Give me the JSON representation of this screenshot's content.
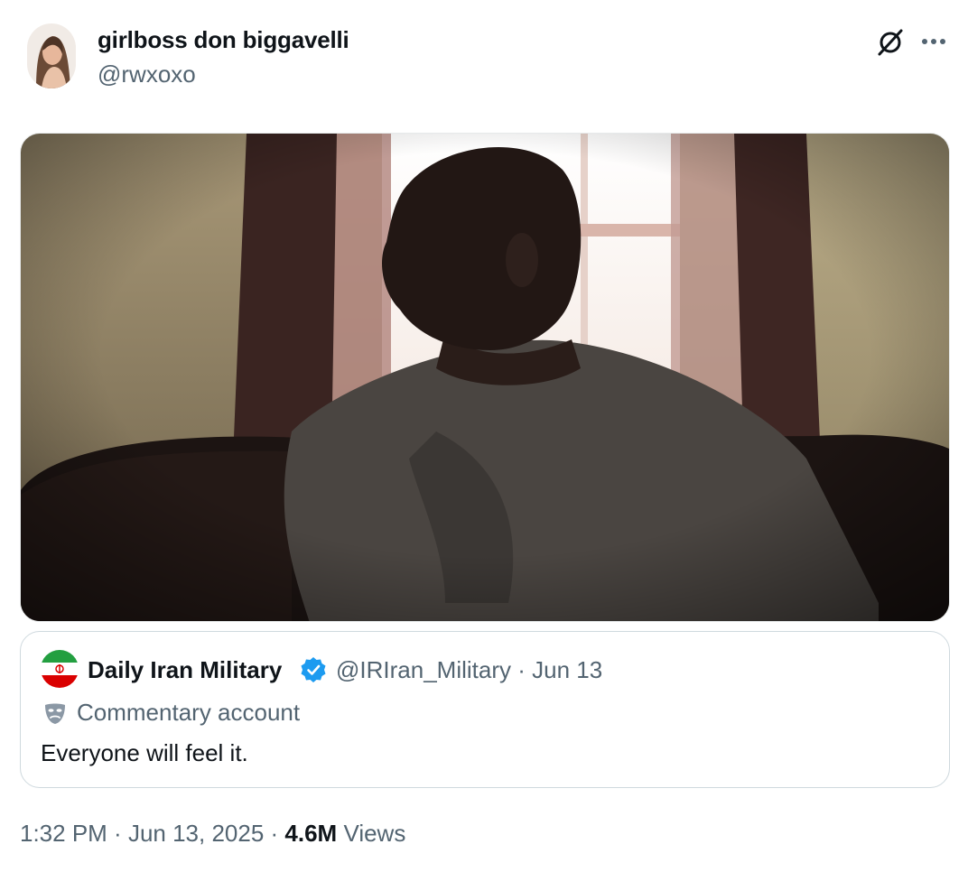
{
  "author": {
    "display_name": "girlboss don biggavelli",
    "handle": "@rwxoxo",
    "avatar_icon": "user-avatar-photo"
  },
  "header_actions": {
    "grok_icon": "grok-slash-circle-icon",
    "more_icon": "ellipsis-icon"
  },
  "media": {
    "kind": "video-still",
    "icon": "embedded-image"
  },
  "quoted_post": {
    "display_name": "Daily Iran Military",
    "handle": "@IRIran_Military",
    "separator": "·",
    "date": "Jun 13",
    "verified_color": "#1d9bf0",
    "account_label": "Commentary account",
    "text": "Everyone will feel it."
  },
  "post_meta": {
    "time": "1:32 PM",
    "separator1": " · ",
    "date": "Jun 13, 2025",
    "separator2": " · ",
    "views_count": "4.6M",
    "views_label": "Views"
  },
  "colors": {
    "text_primary": "#0f1419",
    "text_secondary": "#536471",
    "border": "#cfd9de",
    "accent": "#1d9bf0"
  }
}
